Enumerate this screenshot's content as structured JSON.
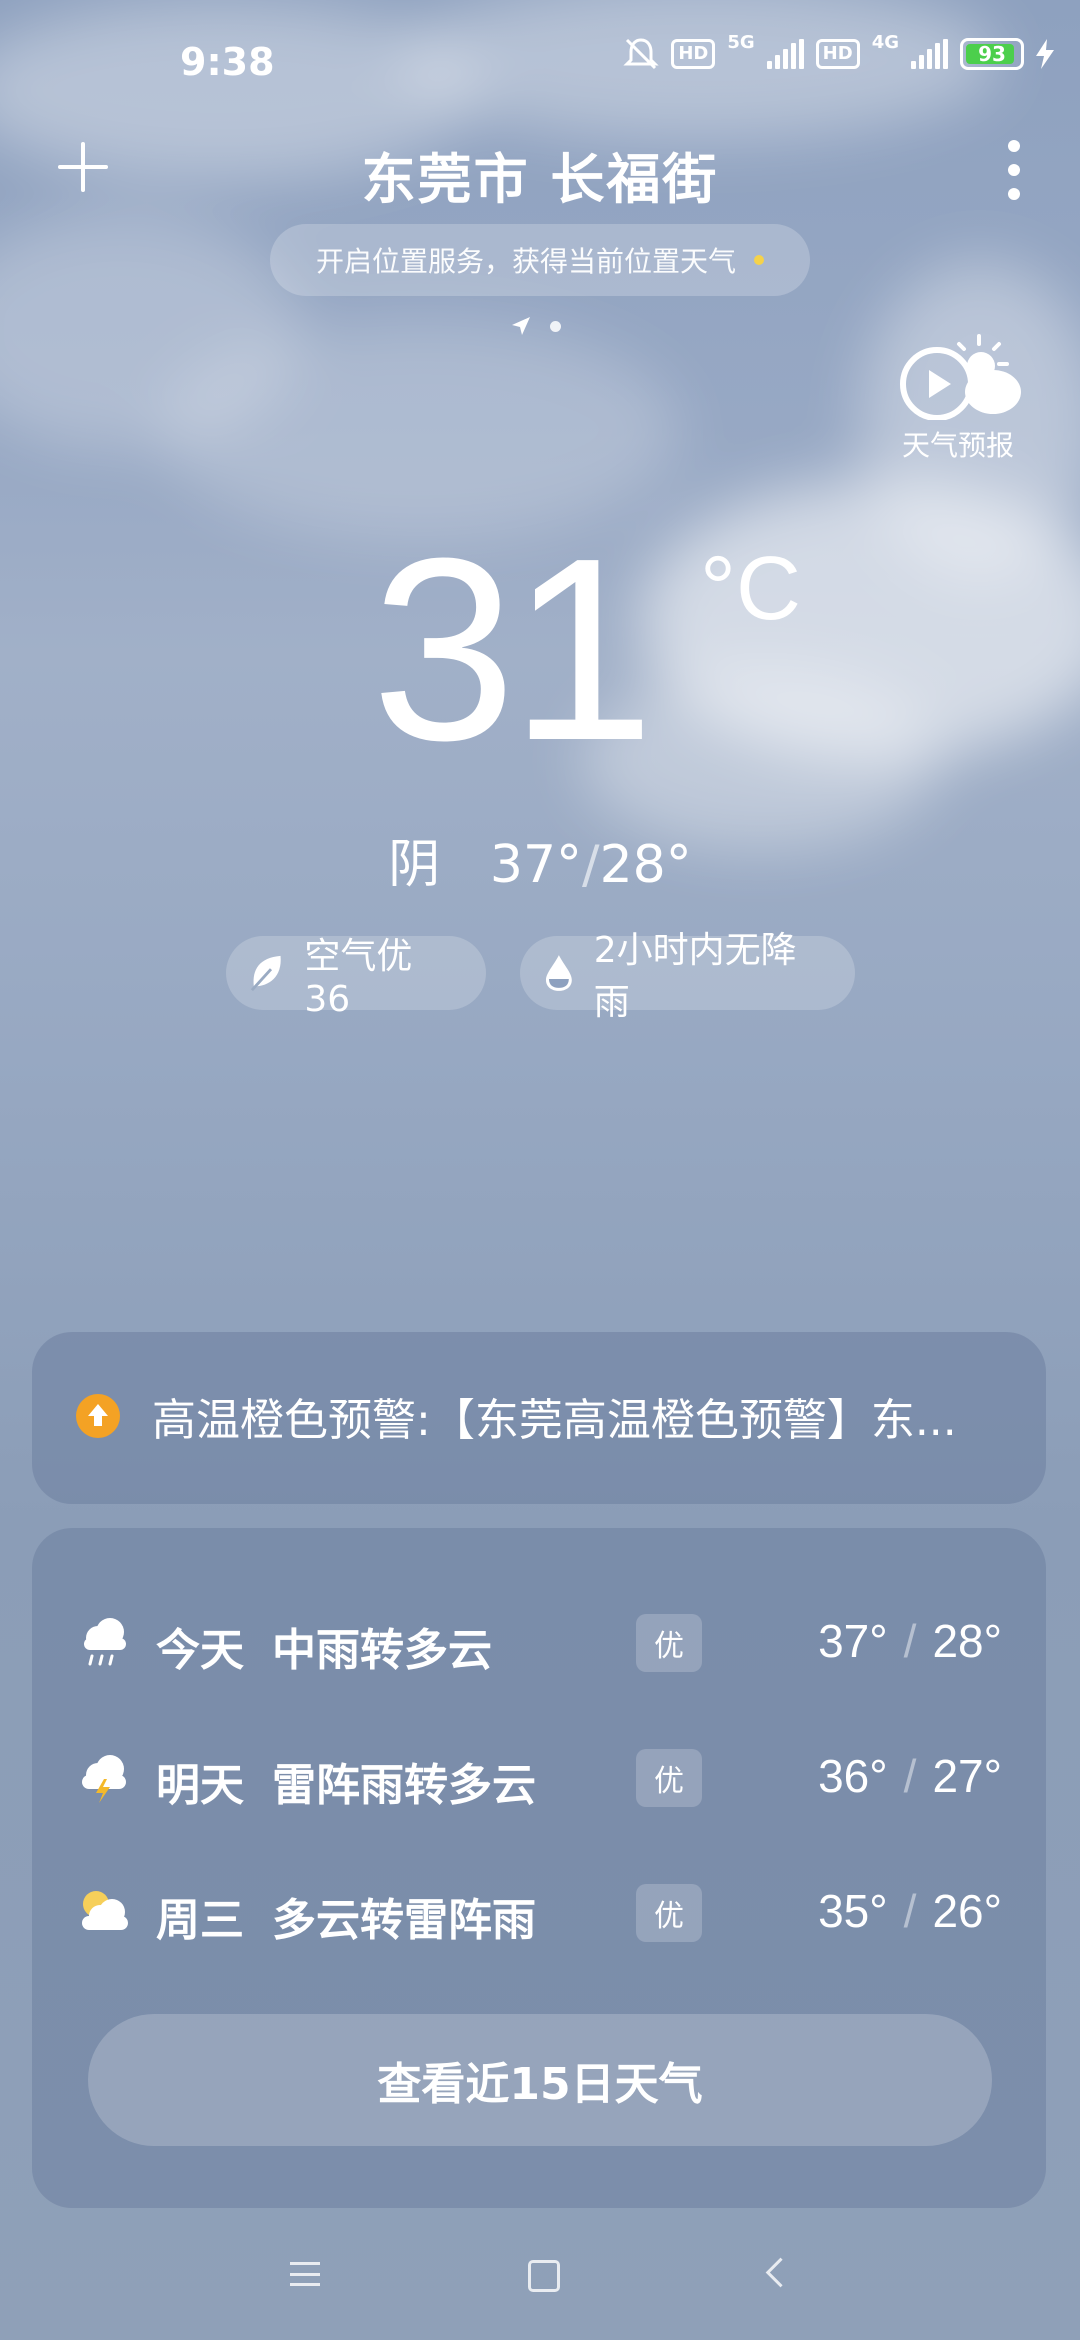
{
  "status_bar": {
    "time": "9:38",
    "hd1": "HD",
    "net1": "5G",
    "hd2": "HD",
    "net2": "4G",
    "battery": "93"
  },
  "header": {
    "city": "东莞市 长福街",
    "location_prompt": "开启位置服务，获得当前位置天气"
  },
  "forecast_video": {
    "label": "天气预报"
  },
  "current": {
    "temperature": "31",
    "unit": "°C",
    "condition": "阴",
    "high": "37°",
    "low": "28°",
    "air": "空气优 36",
    "rain": "2小时内无降雨"
  },
  "alert": {
    "text": "高温橙色预警:【东莞高温橙色预警】东...",
    "color": "#f4a224"
  },
  "days": [
    {
      "name": "今天",
      "desc": "中雨转多云",
      "aqi": "优",
      "high": "37°",
      "low": "28°",
      "icon": "rain-cloud-icon"
    },
    {
      "name": "明天",
      "desc": "雷阵雨转多云",
      "aqi": "优",
      "high": "36°",
      "low": "27°",
      "icon": "thunder-cloud-icon"
    },
    {
      "name": "周三",
      "desc": "多云转雷阵雨",
      "aqi": "优",
      "high": "35°",
      "low": "26°",
      "icon": "sun-cloud-icon"
    }
  ],
  "button_15day": "查看近15日天气",
  "separator": "/"
}
